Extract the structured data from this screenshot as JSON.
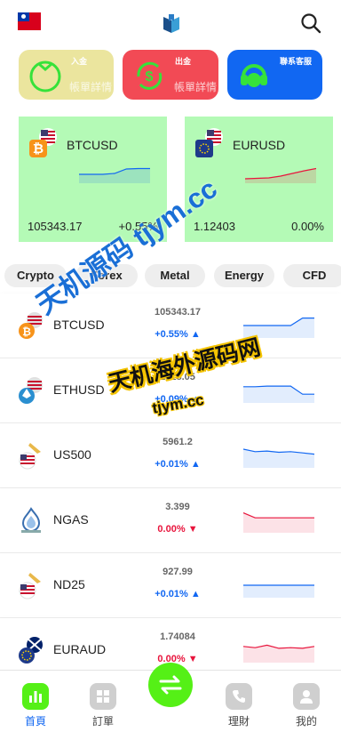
{
  "header": {
    "flag_icon": "taiwan-flag-icon",
    "logo_icon": "app-logo-icon",
    "search_icon": "search-icon"
  },
  "quick_actions": [
    {
      "title": "入金",
      "subtitle": "帳單詳情",
      "icon": "wallet-icon",
      "color": "#ebe59e"
    },
    {
      "title": "出金",
      "subtitle": "帳單詳情",
      "icon": "dollar-cycle-icon",
      "color": "#f24a55"
    },
    {
      "title": "聯系客服",
      "subtitle": "",
      "icon": "headset-icon",
      "color": "#1167f2"
    }
  ],
  "featured": [
    {
      "symbol": "BTCUSD",
      "price": "105343.17",
      "change": "+0.55%",
      "trend": "up",
      "spark": [
        2,
        2,
        2,
        2.2,
        3.2,
        3.3,
        3.3
      ]
    },
    {
      "symbol": "EURUSD",
      "price": "1.12403",
      "change": "0.00%",
      "trend": "down",
      "spark": [
        1,
        1.1,
        1.2,
        1.6,
        2.2,
        2.8,
        3.3
      ]
    }
  ],
  "tabs": [
    "Crypto",
    "Forex",
    "Metal",
    "Energy",
    "CFD"
  ],
  "markets": [
    {
      "symbol": "BTCUSD",
      "price": "105343.17",
      "change": "+0.55%",
      "dir": "up",
      "spark": [
        2,
        2,
        2,
        2,
        2,
        3.2,
        3.2
      ]
    },
    {
      "symbol": "ETHUSD",
      "price": "2518.05",
      "change": "+0.09%",
      "dir": "up",
      "spark": [
        2.6,
        2.6,
        2.7,
        2.7,
        2.7,
        1.4,
        1.4
      ]
    },
    {
      "symbol": "US500",
      "price": "5961.2",
      "change": "+0.01%",
      "dir": "up",
      "spark": [
        3,
        2.6,
        2.7,
        2.5,
        2.6,
        2.4,
        2.2
      ]
    },
    {
      "symbol": "NGAS",
      "price": "3.399",
      "change": "0.00%",
      "dir": "down",
      "spark": [
        3.2,
        2.4,
        2.4,
        2.4,
        2.4,
        2.4,
        2.4
      ]
    },
    {
      "symbol": "ND25",
      "price": "927.99",
      "change": "+0.01%",
      "dir": "up",
      "spark": [
        2,
        2,
        2,
        2,
        2,
        2,
        2
      ]
    },
    {
      "symbol": "EURAUD",
      "price": "1.74084",
      "change": "0.00%",
      "dir": "down",
      "spark": [
        2.6,
        2.4,
        2.8,
        2.3,
        2.4,
        2.3,
        2.6
      ]
    }
  ],
  "watermark": {
    "line1": "天机源码 tjym.cc",
    "line2": "天机海外源码网",
    "line3": "tjym.cc"
  },
  "bottom_nav": [
    {
      "label": "首頁",
      "icon": "chart-bar-icon",
      "active": true
    },
    {
      "label": "訂單",
      "icon": "grid-icon",
      "active": false
    },
    {
      "label": "",
      "icon": "swap-arrows-icon",
      "active": false
    },
    {
      "label": "理財",
      "icon": "phone-icon",
      "active": false
    },
    {
      "label": "我的",
      "icon": "user-icon",
      "active": false
    }
  ],
  "colors": {
    "up": "#1167f2",
    "down": "#e8143c",
    "accent": "#55f016",
    "card": "#b4fab6"
  }
}
